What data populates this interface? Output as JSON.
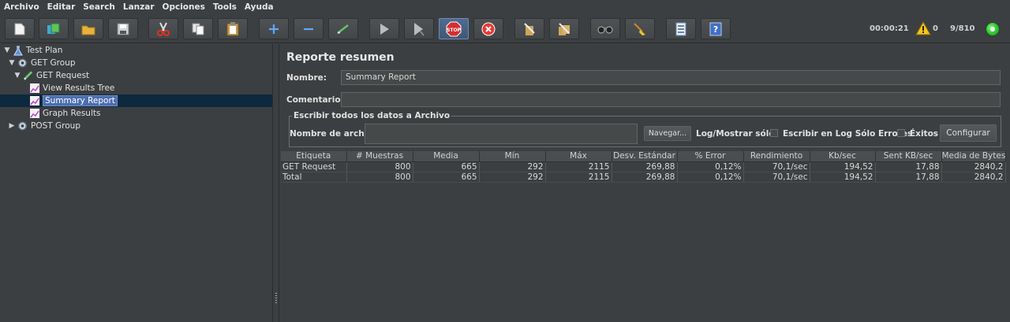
{
  "menu": [
    "Archivo",
    "Editar",
    "Search",
    "Lanzar",
    "Opciones",
    "Tools",
    "Ayuda"
  ],
  "toolbar": {
    "buttons": [
      "new-icon",
      "templates-icon",
      "open-icon",
      "save-icon",
      "cut-icon",
      "copy-icon",
      "paste-icon",
      "expand-icon",
      "collapse-icon",
      "toggle-icon",
      "start-icon",
      "start-no-pauses-icon",
      "stop-icon",
      "shutdown-icon",
      "clear-icon",
      "clear-all-icon",
      "search-icon",
      "reset-search-icon",
      "function-helper-icon",
      "help-icon"
    ]
  },
  "status": {
    "elapsed": "00:00:21",
    "warnings": "0",
    "threads": "9/810"
  },
  "tree": {
    "items": [
      {
        "label": "Test Plan",
        "icon": "flask-icon",
        "expanded": true
      },
      {
        "label": "GET Group",
        "icon": "gear-icon",
        "expanded": true
      },
      {
        "label": "GET Request",
        "icon": "pencil-icon",
        "expanded": true
      },
      {
        "label": "View Results Tree",
        "icon": "graph-icon"
      },
      {
        "label": "Summary Report",
        "icon": "graph-icon",
        "selected": true
      },
      {
        "label": "Graph Results",
        "icon": "graph-icon"
      },
      {
        "label": "POST Group",
        "icon": "gear-icon",
        "expanded": false
      }
    ]
  },
  "panel": {
    "title": "Reporte resumen",
    "name_label": "Nombre:",
    "name_value": "Summary Report",
    "comments_label": "Comentarios",
    "comments_value": "",
    "file_legend": "Escribir todos los datos a Archivo",
    "filename_label": "Nombre de archivo",
    "filename_value": "",
    "browse_label": "Navegar...",
    "log_label": "Log/Mostrar sólo:",
    "errors_label": "Escribir en Log Sólo Errores",
    "success_label": "Éxitos",
    "configure_label": "Configurar"
  },
  "table": {
    "headers": [
      "Etiqueta",
      "# Muestras",
      "Media",
      "Mín",
      "Máx",
      "Desv. Estándar",
      "% Error",
      "Rendimiento",
      "Kb/sec",
      "Sent KB/sec",
      "Media de Bytes"
    ],
    "rows": [
      [
        "GET Request",
        "800",
        "665",
        "292",
        "2115",
        "269,88",
        "0,12%",
        "70,1/sec",
        "194,52",
        "17,88",
        "2840,2"
      ],
      [
        "Total",
        "800",
        "665",
        "292",
        "2115",
        "269,88",
        "0,12%",
        "70,1/sec",
        "194,52",
        "17,88",
        "2840,2"
      ]
    ]
  }
}
